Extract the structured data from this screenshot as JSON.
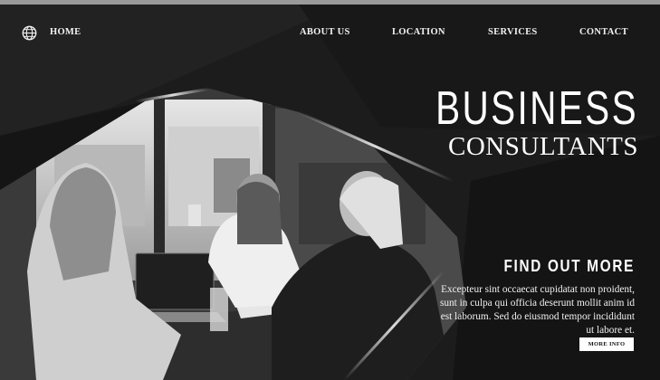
{
  "nav": {
    "home": "HOME",
    "about": "ABOUT US",
    "location": "LOCATION",
    "services": "SERVICES",
    "contact": "CONTACT"
  },
  "hero": {
    "title_line1": "BUSINESS",
    "title_line2": "CONSULTANTS"
  },
  "cta": {
    "heading": "FIND OUT MORE",
    "body": "Excepteur sint occaecat cupidatat non proident, sunt in culpa qui officia deserunt mollit anim id est laborum. Sed do eiusmod tempor incididunt ut labore et.",
    "button": "MORE INFO"
  },
  "icons": {
    "globe": "globe-icon"
  },
  "colors": {
    "background": "#1b1b1b",
    "text": "#ffffff",
    "button_bg": "#ffffff",
    "button_text": "#111111"
  }
}
